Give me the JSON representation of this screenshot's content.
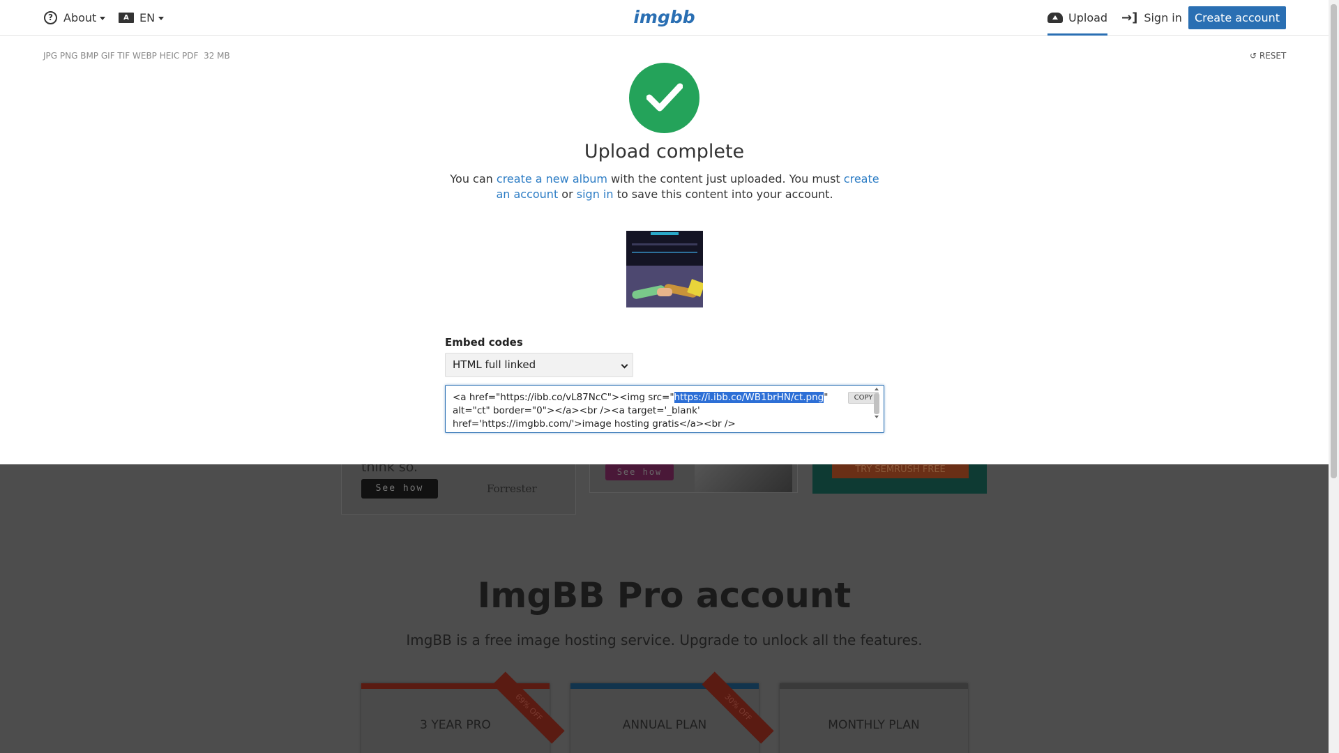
{
  "header": {
    "about_label": "About",
    "lang_label": "EN",
    "lang_icon_text": "A",
    "logo_text": "imgbb",
    "upload_label": "Upload",
    "signin_label": "Sign in",
    "create_account_label": "Create account"
  },
  "upload": {
    "formats": "JPG PNG BMP GIF TIF WEBP HEIC PDF",
    "max_size": "32 MB",
    "reset_label": "RESET",
    "title": "Upload complete",
    "desc_1": "You can ",
    "desc_link_album": "create a new album",
    "desc_2": " with the content just uploaded. You must ",
    "desc_link_account": "create an account",
    "desc_3": " or ",
    "desc_link_signin": "sign in",
    "desc_4": " to save this content into your account."
  },
  "embed": {
    "label": "Embed codes",
    "selected_option": "HTML full linked",
    "code_before": "<a href=\"https://ibb.co/vL87NcC\"><img src=\"",
    "code_selected": "https://i.ibb.co/WB1brHN/ct.png",
    "code_after": "\" alt=\"ct\" border=\"0\"></a><br /><a target='_blank' href='https://imgbb.com/'>image hosting gratis</a><br />",
    "copy_label": "COPY"
  },
  "background": {
    "ad1_text": "think so.",
    "ad1_button": "See how",
    "ad1_brand": "Forrester",
    "ad2_button": "See how",
    "ad3_button": "TRY SEMRUSH FREE",
    "pro_title": "ImgBB Pro account",
    "pro_subtitle": "ImgBB is a free image hosting service. Upgrade to unlock all the features.",
    "plans": [
      {
        "label": "3 YEAR PRO",
        "ribbon": "69% OFF"
      },
      {
        "label": "ANNUAL PLAN",
        "ribbon": "30% OFF"
      },
      {
        "label": "MONTHLY PLAN"
      }
    ]
  },
  "colors": {
    "accent": "#2a6fb3",
    "success": "#24a35a",
    "link": "#2a7bc4"
  }
}
